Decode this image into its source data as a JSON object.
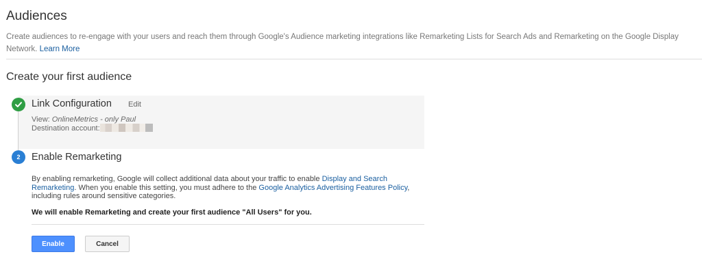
{
  "header": {
    "title": "Audiences",
    "intro_text": "Create audiences to re-engage with your users and reach them through Google's Audience marketing integrations like Remarketing Lists for Search Ads and Remarketing on the Google Display Network.",
    "learn_more": "Learn More"
  },
  "section": {
    "title": "Create your first audience"
  },
  "step1": {
    "title": "Link Configuration",
    "edit_label": "Edit",
    "view_label": "View:",
    "view_value": "OnlineMetrics - only Paul",
    "destination_label": "Destination account:",
    "status_color": "#2f9e44"
  },
  "step2": {
    "number": "2",
    "title": "Enable Remarketing",
    "body_part1": "By enabling remarketing, Google will collect additional data about your traffic to enable ",
    "body_link1": "Display and Search Remarketing",
    "body_part2": ". When you enable this setting, you must adhere to the ",
    "body_link2": "Google Analytics Advertising Features Policy",
    "body_part3": ", including rules around sensitive categories.",
    "strong_text": "We will enable Remarketing and create your first audience \"All Users\" for you.",
    "badge_color": "#2a7fd4"
  },
  "actions": {
    "enable_label": "Enable",
    "cancel_label": "Cancel",
    "primary_color": "#4d90fe"
  }
}
